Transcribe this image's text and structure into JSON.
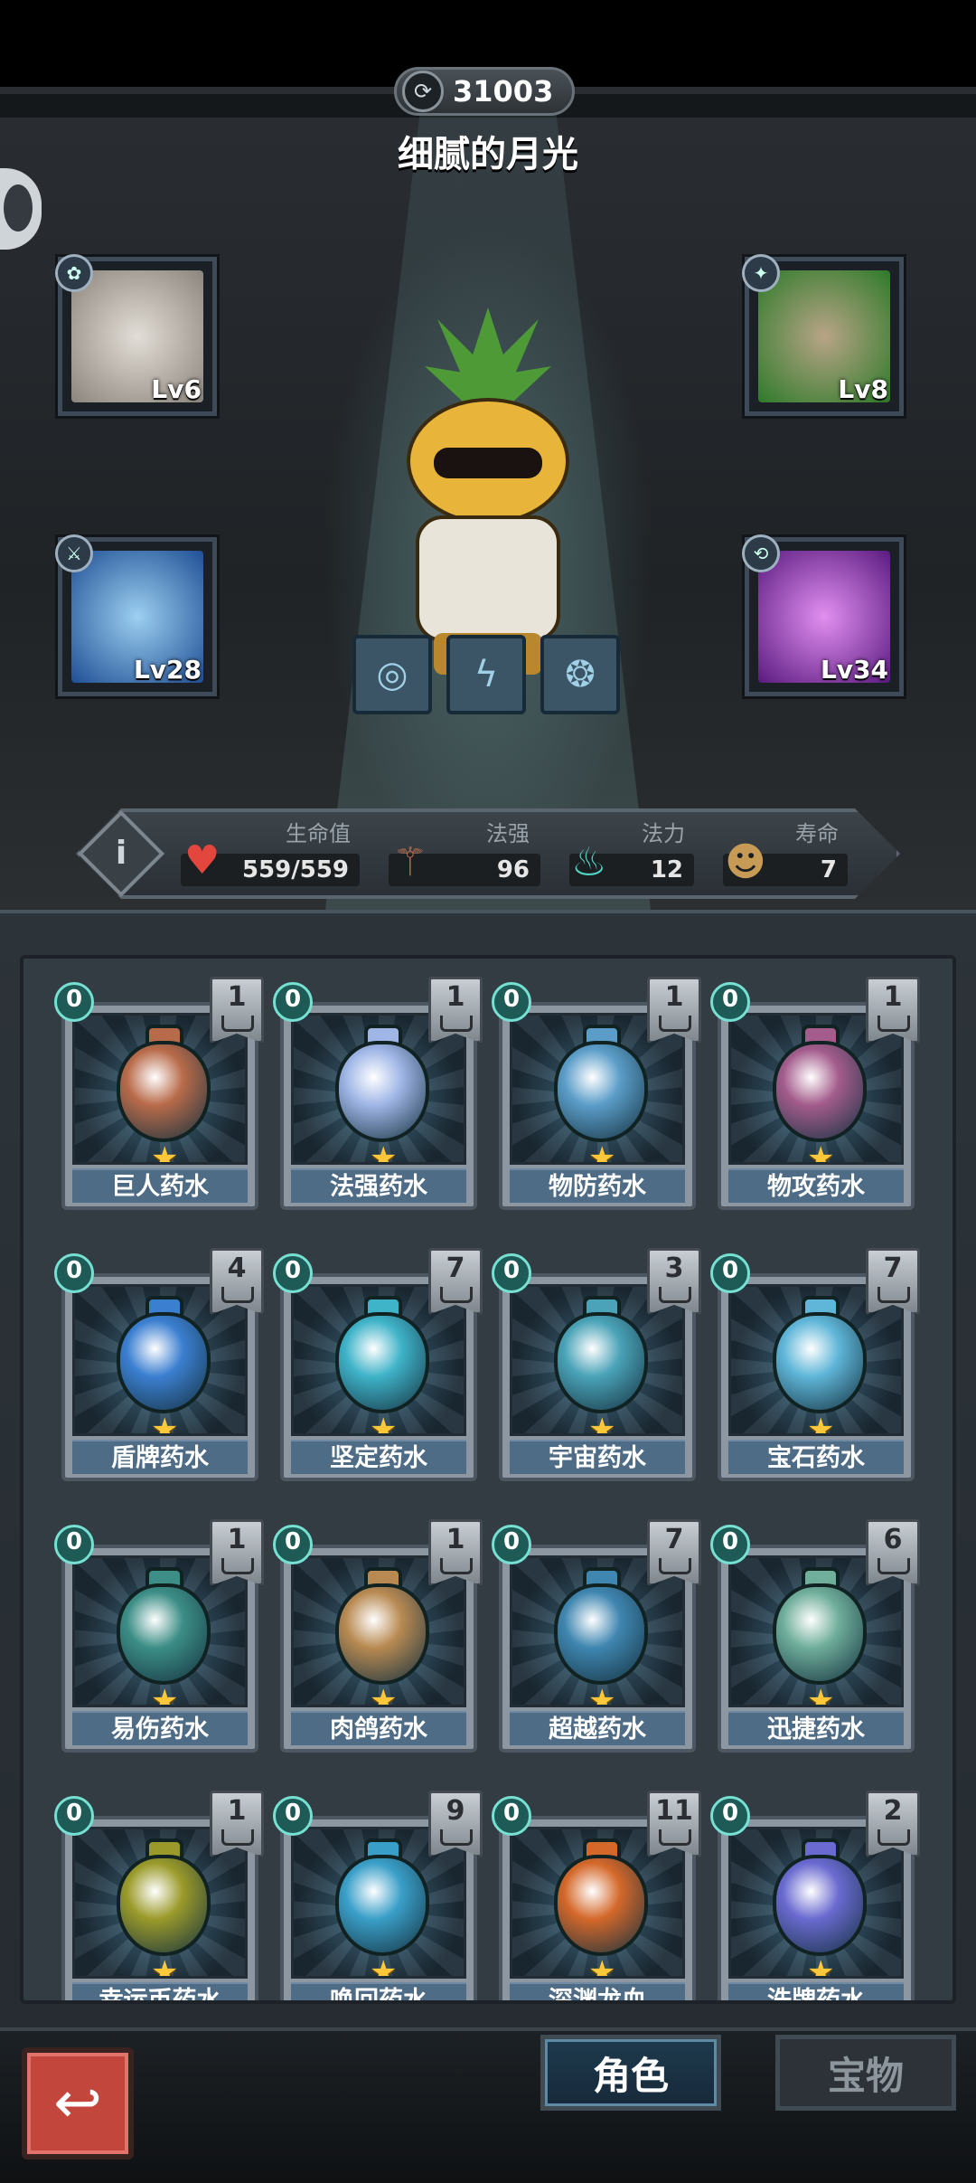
{
  "hero": {
    "score": "31003",
    "name": "细腻的月光"
  },
  "equipment": [
    {
      "slot": "top-left",
      "level": "Lv6",
      "color": "#b9b3ab",
      "badge_icon": "paw-icon"
    },
    {
      "slot": "top-right",
      "level": "Lv8",
      "color": "#3c9a3a",
      "badge_icon": "spirit-icon"
    },
    {
      "slot": "bottom-left",
      "level": "Lv28",
      "color": "#2f6fb5",
      "badge_icon": "sword-icon"
    },
    {
      "slot": "bottom-right",
      "level": "Lv34",
      "color": "#8b2ab8",
      "badge_icon": "swap-icon"
    }
  ],
  "stats": {
    "hp": {
      "label": "生命值",
      "value": "559/559"
    },
    "magic_power": {
      "label": "法强",
      "value": "96"
    },
    "mana": {
      "label": "法力",
      "value": "12"
    },
    "lifespan": {
      "label": "寿命",
      "value": "7"
    }
  },
  "potions": [
    {
      "name": "巨人药水",
      "cost": "0",
      "count": "1",
      "color": "#b86b4a"
    },
    {
      "name": "法强药水",
      "cost": "0",
      "count": "1",
      "color": "#9fb6e6"
    },
    {
      "name": "物防药水",
      "cost": "0",
      "count": "1",
      "color": "#5b9dc8"
    },
    {
      "name": "物攻药水",
      "cost": "0",
      "count": "1",
      "color": "#a35c8c"
    },
    {
      "name": "盾牌药水",
      "cost": "0",
      "count": "4",
      "color": "#3b7fd0"
    },
    {
      "name": "坚定药水",
      "cost": "0",
      "count": "7",
      "color": "#3fb3c8"
    },
    {
      "name": "宇宙药水",
      "cost": "0",
      "count": "3",
      "color": "#4aa3b8"
    },
    {
      "name": "宝石药水",
      "cost": "0",
      "count": "7",
      "color": "#5fb6d8"
    },
    {
      "name": "易伤药水",
      "cost": "0",
      "count": "1",
      "color": "#3c8e86"
    },
    {
      "name": "肉鸽药水",
      "cost": "0",
      "count": "1",
      "color": "#b88a52"
    },
    {
      "name": "超越药水",
      "cost": "0",
      "count": "7",
      "color": "#3f86b0"
    },
    {
      "name": "迅捷药水",
      "cost": "0",
      "count": "6",
      "color": "#6fae9a"
    },
    {
      "name": "幸运币药水",
      "cost": "0",
      "count": "1",
      "color": "#9a9a2a"
    },
    {
      "name": "唤回药水",
      "cost": "0",
      "count": "9",
      "color": "#3a9fc8"
    },
    {
      "name": "深渊龙血",
      "cost": "0",
      "count": "11",
      "color": "#d4682a"
    },
    {
      "name": "洗牌药水",
      "cost": "0",
      "count": "2",
      "color": "#6a6ad0"
    }
  ],
  "nav": {
    "character_label": "角色",
    "treasure_label": "宝物"
  }
}
